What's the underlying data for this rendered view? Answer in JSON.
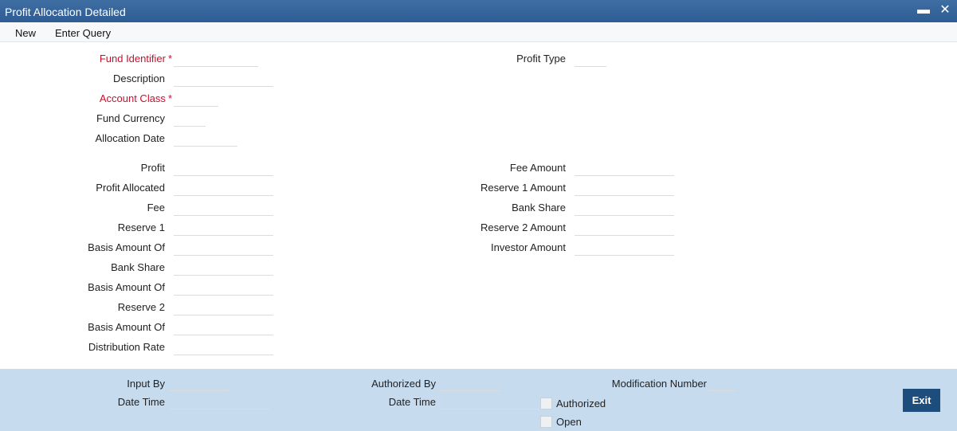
{
  "window": {
    "title": "Profit Allocation Detailed",
    "minimize_glyph": "▬",
    "close_glyph": "✕"
  },
  "menu": {
    "new": "New",
    "enter_query": "Enter Query"
  },
  "required_marker": "*",
  "header": {
    "fund_identifier": {
      "label": "Fund Identifier",
      "value": ""
    },
    "description": {
      "label": "Description",
      "value": ""
    },
    "account_class": {
      "label": "Account Class",
      "value": ""
    },
    "fund_currency": {
      "label": "Fund Currency",
      "value": ""
    },
    "allocation_date": {
      "label": "Allocation Date",
      "value": ""
    },
    "profit_type": {
      "label": "Profit Type",
      "value": ""
    }
  },
  "left_amounts": [
    {
      "label": "Profit",
      "value": ""
    },
    {
      "label": "Profit Allocated",
      "value": ""
    },
    {
      "label": "Fee",
      "value": ""
    },
    {
      "label": "Reserve 1",
      "value": ""
    },
    {
      "label": "Basis Amount Of",
      "value": ""
    },
    {
      "label": "Bank Share",
      "value": ""
    },
    {
      "label": "Basis Amount Of",
      "value": ""
    },
    {
      "label": "Reserve 2",
      "value": ""
    },
    {
      "label": "Basis Amount Of",
      "value": ""
    },
    {
      "label": "Distribution Rate",
      "value": ""
    }
  ],
  "right_amounts": [
    {
      "label": "Fee Amount",
      "value": ""
    },
    {
      "label": "Reserve 1 Amount",
      "value": ""
    },
    {
      "label": "Bank Share",
      "value": ""
    },
    {
      "label": "Reserve 2 Amount",
      "value": ""
    },
    {
      "label": "Investor Amount",
      "value": ""
    }
  ],
  "footer": {
    "input_by": "Input By",
    "input_date_time": "Date Time",
    "authorized_by": "Authorized By",
    "authorized_date_time": "Date Time",
    "modification_number": "Modification Number",
    "authorized": "Authorized",
    "open": "Open",
    "exit": "Exit"
  }
}
